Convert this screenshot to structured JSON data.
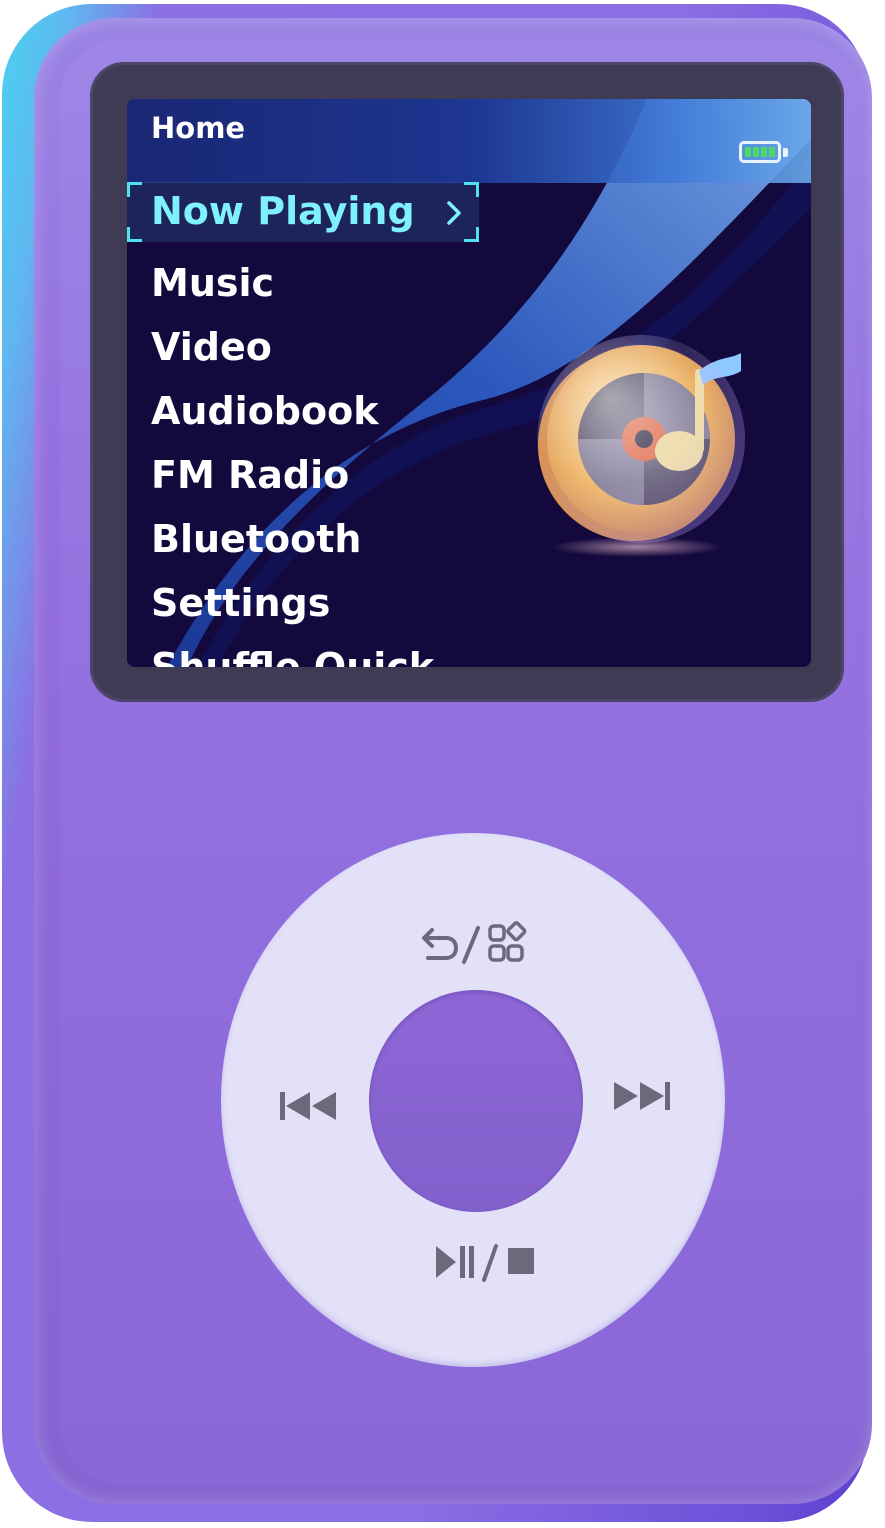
{
  "screen": {
    "title": "Home",
    "battery_icon": "battery-full-icon",
    "menu_items": [
      {
        "label": "Now Playing",
        "selected": true
      },
      {
        "label": "Music",
        "selected": false
      },
      {
        "label": "Video",
        "selected": false
      },
      {
        "label": "Audiobook",
        "selected": false
      },
      {
        "label": "FM Radio",
        "selected": false
      },
      {
        "label": "Bluetooth",
        "selected": false
      },
      {
        "label": "Settings",
        "selected": false
      },
      {
        "label": "Shuffle Quick",
        "selected": false
      }
    ],
    "now_playing_art_icon": "music-disc-icon"
  },
  "click_wheel": {
    "top_icon": "back-and-menu-icon",
    "left_icon": "previous-track-icon",
    "right_icon": "next-track-icon",
    "bottom_icon": "play-pause-stop-icon",
    "center_icon": "select-button"
  },
  "colors": {
    "device_body": "#8d68da",
    "screen_bg": "#13093d",
    "selected_text": "#7ff0ff",
    "battery_green": "#4cd964",
    "wheel": "#e2e1f8",
    "wheel_glyphs": "#6b6a7a"
  }
}
